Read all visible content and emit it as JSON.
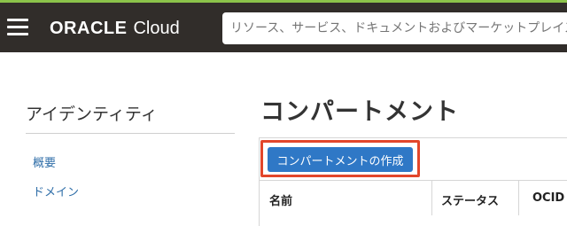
{
  "header": {
    "brand_oracle": "ORACLE",
    "brand_cloud": "Cloud",
    "search_placeholder": "リソース、サービス、ドキュメントおよびマーケットプレイスの検索"
  },
  "sidebar": {
    "title": "アイデンティティ",
    "items": [
      {
        "label": "概要"
      },
      {
        "label": "ドメイン"
      },
      {
        "label": ""
      }
    ]
  },
  "main": {
    "title": "コンパートメント",
    "create_button": "コンパートメントの作成",
    "table": {
      "columns": [
        "名前",
        "ステータス",
        "OCID"
      ]
    }
  },
  "colors": {
    "topbar": "#312d2a",
    "accent_strip": "#8bc34a",
    "primary_button": "#2f78c6",
    "highlight_border": "#e2462b",
    "link": "#2f6ea8"
  }
}
